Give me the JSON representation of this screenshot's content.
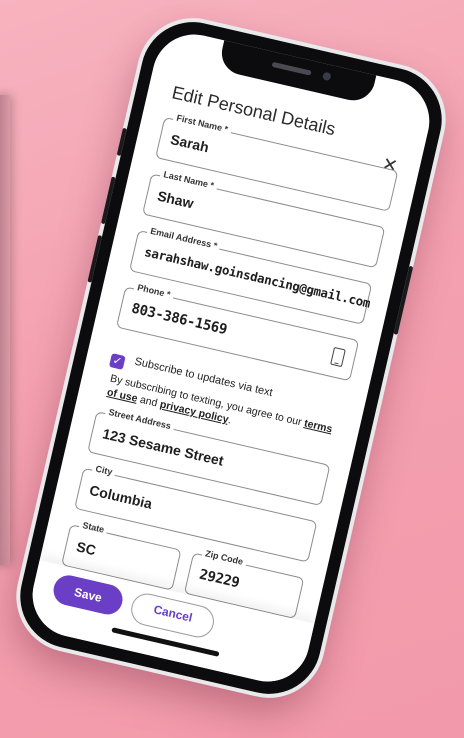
{
  "modal": {
    "title": "Edit Personal Details",
    "close_icon": "close-icon"
  },
  "fields": {
    "first_name": {
      "label": "First Name *",
      "value": "Sarah"
    },
    "last_name": {
      "label": "Last Name *",
      "value": "Shaw"
    },
    "email": {
      "label": "Email Address *",
      "value": "sarahshaw.goinsdancing@gmail.com"
    },
    "phone": {
      "label": "Phone *",
      "value": "803-386-1569",
      "icon": "mobile-phone-icon"
    },
    "street": {
      "label": "Street Address",
      "value": "123 Sesame Street"
    },
    "city": {
      "label": "City",
      "value": "Columbia"
    },
    "state": {
      "label": "State",
      "value": "SC"
    },
    "zip": {
      "label": "Zip Code",
      "value": "29229"
    }
  },
  "subscribe": {
    "checked": true,
    "label": "Subscribe to updates via text",
    "consent_prefix": "By subscribing to texting, you agree to our",
    "terms_link": "terms of use",
    "and_text": "and",
    "privacy_link": "privacy policy",
    "period": "."
  },
  "actions": {
    "save_label": "Save",
    "cancel_label": "Cancel"
  },
  "colors": {
    "accent": "#6a3fc6",
    "background": "#f4a0b0"
  }
}
